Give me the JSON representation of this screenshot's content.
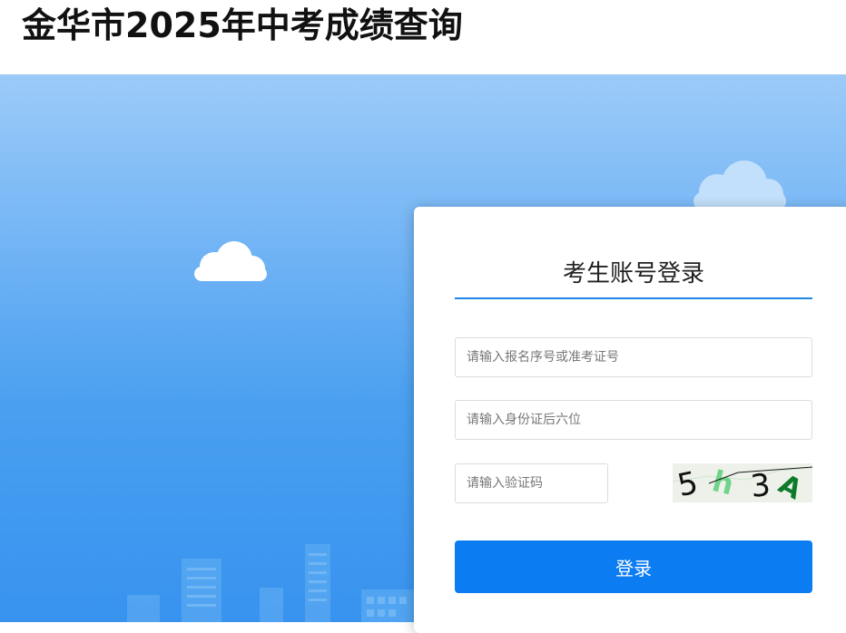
{
  "header": {
    "title": "金华市2025年中考成绩查询"
  },
  "login": {
    "title": "考生账号登录",
    "exam_number_placeholder": "请输入报名序号或准考证号",
    "id_card_placeholder": "请输入身份证后六位",
    "captcha_placeholder": "请输入验证码",
    "captcha_text": "5h3A",
    "submit_label": "登录"
  },
  "colors": {
    "accent": "#0b7cf2",
    "title_underline": "#1e88e5",
    "sky_top": "#9ccbf8",
    "sky_bottom": "#3893ef"
  }
}
